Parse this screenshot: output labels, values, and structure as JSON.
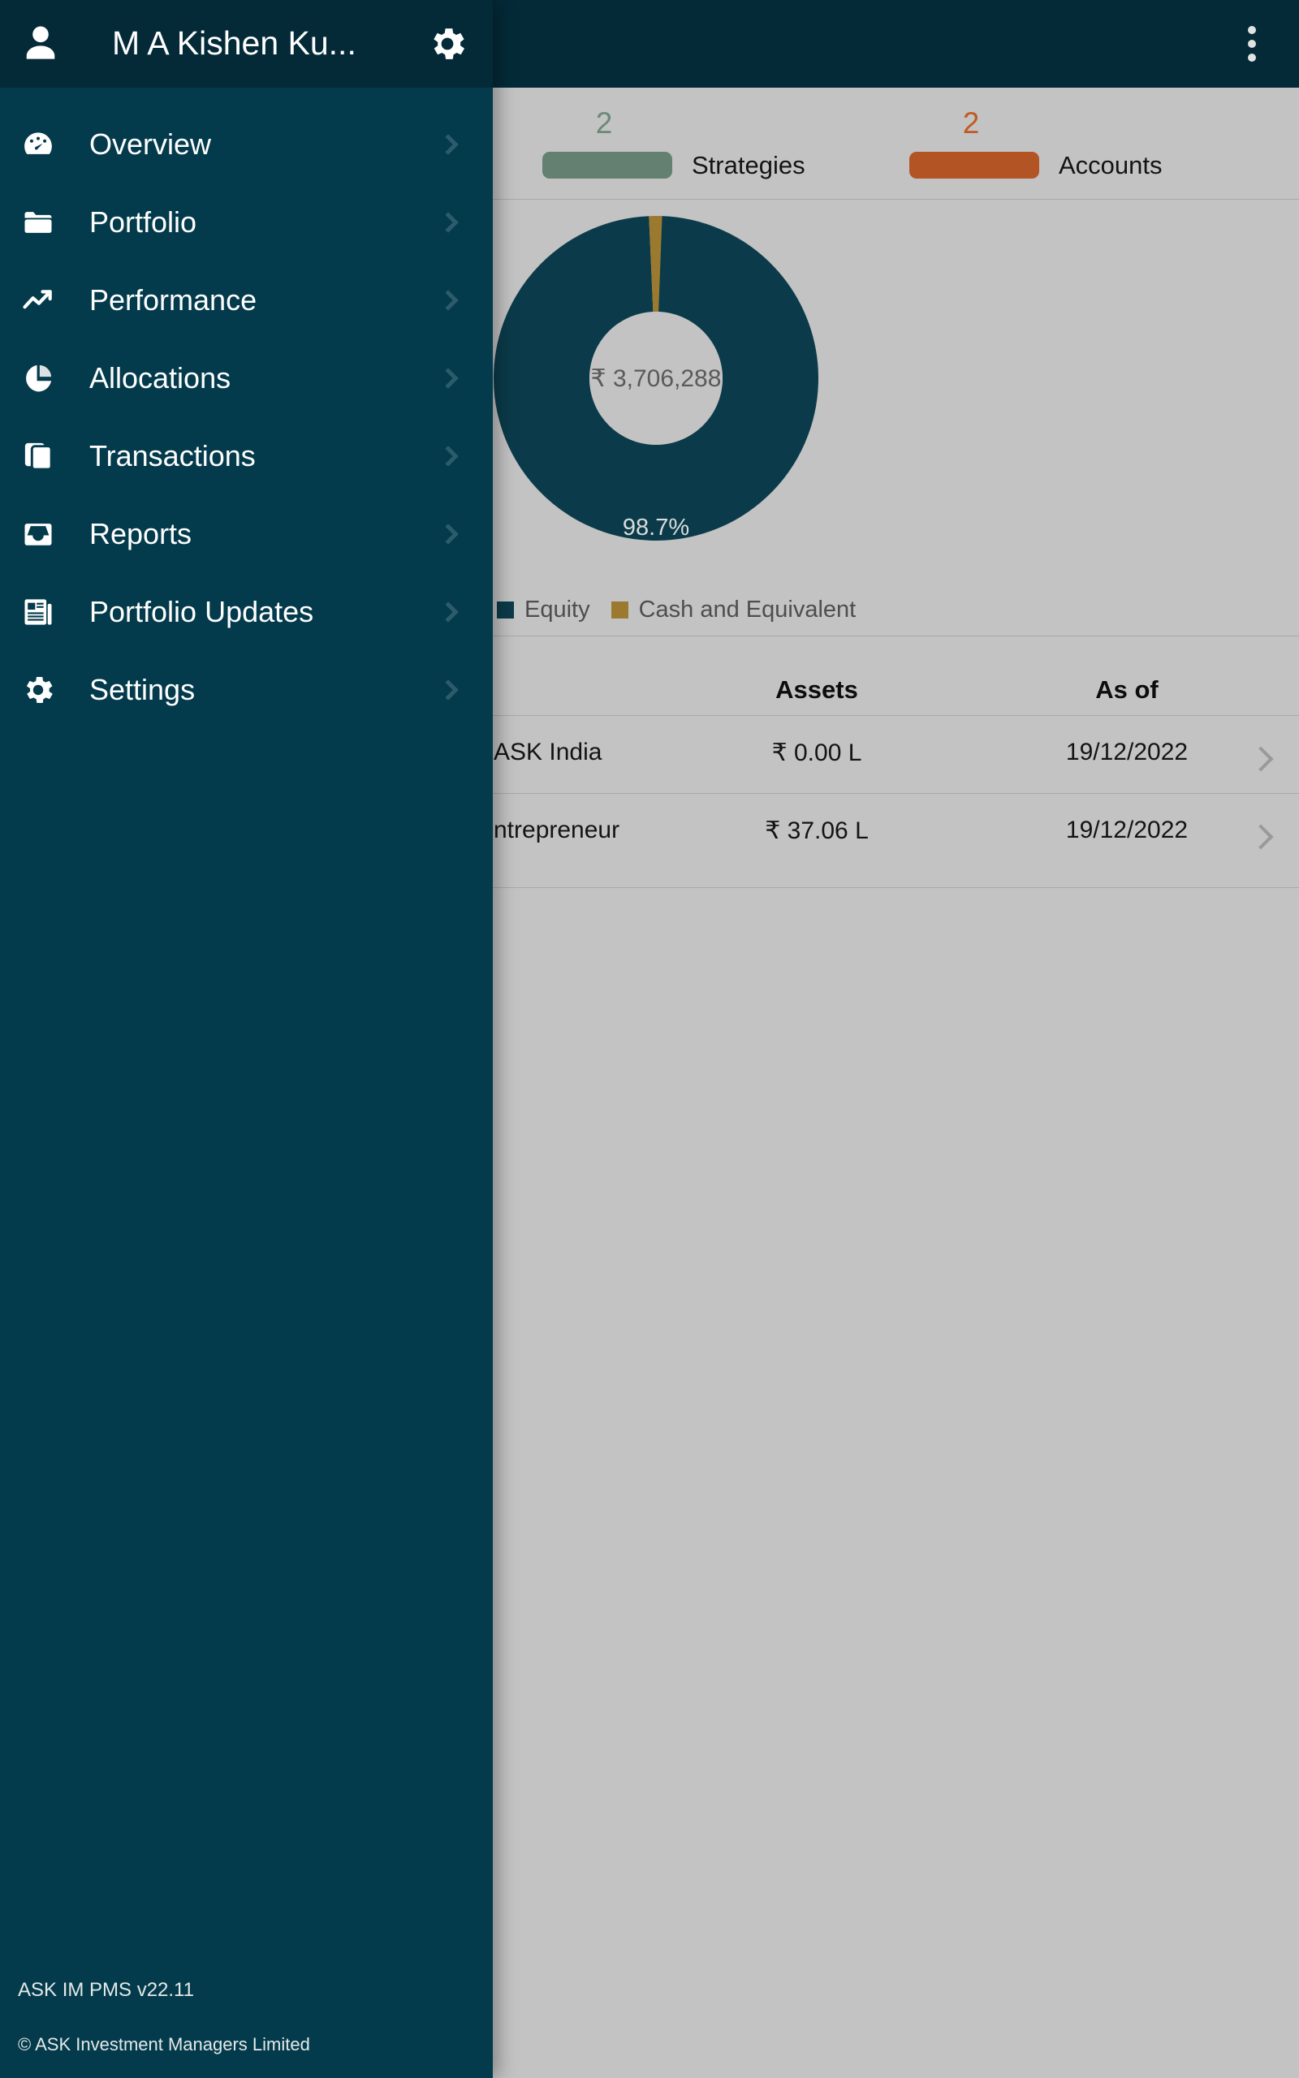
{
  "app_bar": {
    "overflow_menu": "more-vertical"
  },
  "drawer": {
    "title": "M A Kishen Ku...",
    "avatar_icon": "person-icon",
    "settings_icon": "gear-icon",
    "items": [
      {
        "label": "Overview",
        "icon": "speedometer-icon"
      },
      {
        "label": "Portfolio",
        "icon": "folder-icon"
      },
      {
        "label": "Performance",
        "icon": "trending-up-icon"
      },
      {
        "label": "Allocations",
        "icon": "pie-chart-icon"
      },
      {
        "label": "Transactions",
        "icon": "copy-icon"
      },
      {
        "label": "Reports",
        "icon": "inbox-icon"
      },
      {
        "label": "Portfolio Updates",
        "icon": "newspaper-icon"
      },
      {
        "label": "Settings",
        "icon": "gear-icon"
      }
    ],
    "version": "ASK IM PMS v22.11",
    "copyright": "© ASK Investment Managers Limited"
  },
  "stats": [
    {
      "count": "2",
      "label": "Strategies",
      "color": "#648070"
    },
    {
      "count": "2",
      "label": "Accounts",
      "color": "#b35425"
    }
  ],
  "chart_data": {
    "type": "pie",
    "title": "",
    "center_value": "₹ 3,706,288",
    "labels": [
      "Equity",
      "Cash and Equivalent"
    ],
    "values": [
      98.7,
      1.3
    ],
    "value_labels": [
      "98.7%",
      ""
    ],
    "colors": [
      "#0b3b4a",
      "#9b7a30"
    ],
    "legend_position": "bottom",
    "donut": true,
    "inner_radius_ratio": 0.59
  },
  "table": {
    "headers": {
      "name": "",
      "assets": "Assets",
      "as_of": "As of"
    },
    "rows": [
      {
        "name": "ASK India",
        "assets": "₹ 0.00 L",
        "as_of": "19/12/2022"
      },
      {
        "name": "ntrepreneur",
        "assets": "₹ 37.06 L",
        "as_of": "19/12/2022"
      }
    ]
  },
  "colors": {
    "drawer_bg": "#043b4c",
    "appbar_bg": "#042a38",
    "scrim_bg": "#c3c3c3",
    "equity": "#0b3b4a",
    "cash": "#9b7a30",
    "strategies": "#648070",
    "accounts": "#b35425"
  }
}
